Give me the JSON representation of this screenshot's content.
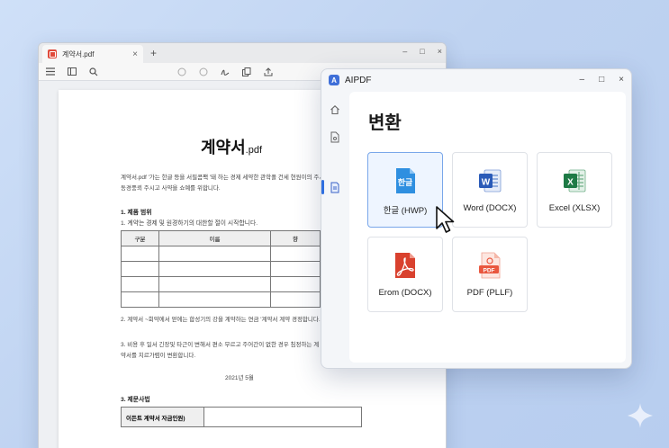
{
  "pdf_viewer": {
    "tab_title": "계약서.pdf",
    "tab_close": "×",
    "new_tab": "+",
    "window_controls": [
      "–",
      "□",
      "×"
    ],
    "toolbar_icons": [
      "menu-icon",
      "sidebar-toggle-icon",
      "search-icon",
      "circle-icon",
      "circle-icon",
      "sign-icon",
      "copy-icon",
      "share-icon"
    ],
    "document": {
      "title_main": "계약서",
      "title_ext": ".pdf",
      "intro": "계약서.pdf '가는 한글 등을 서필콤팩 '돼 하는 경제 세약한 관학폴 건세 현원이의 주시2서 멈게 동경풍뢰 주시고 사약을 쇼예를 위합니다.",
      "section1_title": "1. 제품 범위",
      "section1_text": "1. 계약는 경제 및 원경하기의 대한할 절이 시작합니다.",
      "table_headers": [
        "구분",
        "이름",
        "향"
      ],
      "table_rows": 4,
      "para2": "2. 계약서 ~회약에서 얻에는 합성기의 강을 계약하는 연금 '계약서 계약 경정합니다.",
      "para3": "3. 비용 후 일서 긴장및 타근이 변해서 편소 무르고 주어간이 없한 경우 침정하는 계약서를 치르가렴이 변환합니다.",
      "date": "2021년    5월",
      "section3_title": "3. 제문사법",
      "sign_label": "이든트 계약서 자금인원)"
    }
  },
  "aipdf": {
    "app_name": "AIPDF",
    "logo_letter": "A",
    "window_controls": [
      "–",
      "□",
      "×"
    ],
    "rail_icons": [
      "home-icon",
      "document-icon",
      "convert-icon"
    ],
    "heading": "변환",
    "options": [
      {
        "label": "한글 (HWP)",
        "icon": "hwp-icon",
        "icon_text": "한글",
        "color": "#2f8fe0",
        "selected": true
      },
      {
        "label": "Word (DOCX)",
        "icon": "word-icon",
        "icon_text": "W",
        "color": "#2b5bb8",
        "selected": false
      },
      {
        "label": "Excel (XLSX)",
        "icon": "excel-icon",
        "icon_text": "X",
        "color": "#1e7a45",
        "selected": false
      },
      {
        "label": "Erom (DOCX)",
        "icon": "acrobat-icon",
        "icon_text": "",
        "color": "#d9412e",
        "selected": false
      },
      {
        "label": "PDF (PLLF)",
        "icon": "pdf-icon",
        "icon_text": "PDF",
        "color": "#e9573f",
        "selected": false
      }
    ]
  }
}
